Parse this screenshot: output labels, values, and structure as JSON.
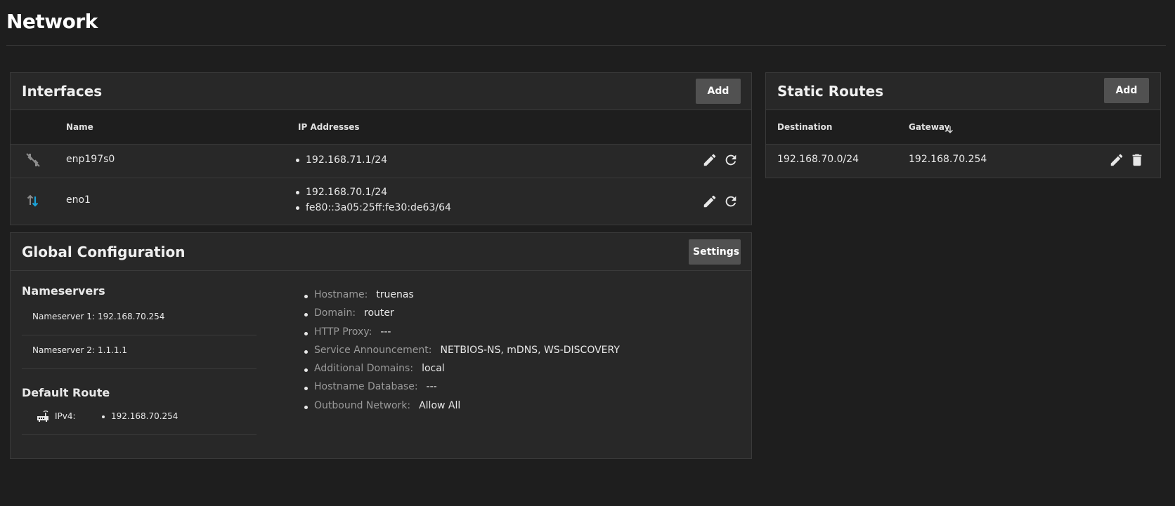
{
  "page": {
    "title": "Network"
  },
  "interfaces": {
    "title": "Interfaces",
    "add_label": "Add",
    "columns": {
      "name": "Name",
      "ip": "IP Addresses"
    },
    "rows": [
      {
        "name": "enp197s0",
        "status_icon": "link-down-icon",
        "ips": [
          "192.168.71.1/24"
        ]
      },
      {
        "name": "eno1",
        "status_icon": "traffic-arrows-icon",
        "ips": [
          "192.168.70.1/24",
          "fe80::3a05:25ff:fe30:de63/64"
        ]
      }
    ]
  },
  "static_routes": {
    "title": "Static Routes",
    "add_label": "Add",
    "columns": {
      "destination": "Destination",
      "gateway": "Gateway"
    },
    "sort_icon": "arrow-down-icon",
    "rows": [
      {
        "destination": "192.168.70.0/24",
        "gateway": "192.168.70.254"
      }
    ]
  },
  "global_config": {
    "title": "Global Configuration",
    "settings_label": "Settings",
    "nameservers_title": "Nameservers",
    "nameservers": [
      {
        "label": "Nameserver 1:",
        "value": "192.168.70.254"
      },
      {
        "label": "Nameserver 2:",
        "value": "1.1.1.1"
      }
    ],
    "default_route_title": "Default Route",
    "default_route": {
      "label": "IPv4:",
      "value": "192.168.70.254",
      "icon": "router-icon"
    },
    "details": [
      {
        "key": "Hostname:",
        "value": "truenas"
      },
      {
        "key": "Domain:",
        "value": "router"
      },
      {
        "key": "HTTP Proxy:",
        "value": "---"
      },
      {
        "key": "Service Announcement:",
        "value": "NETBIOS-NS, mDNS, WS-DISCOVERY"
      },
      {
        "key": "Additional Domains:",
        "value": "local"
      },
      {
        "key": "Hostname Database:",
        "value": "---"
      },
      {
        "key": "Outbound Network:",
        "value": "Allow All"
      }
    ]
  },
  "colors": {
    "background": "#1e1e1e",
    "card": "#282828",
    "button": "#515151",
    "accent_arrow": "#1aa3d9"
  }
}
